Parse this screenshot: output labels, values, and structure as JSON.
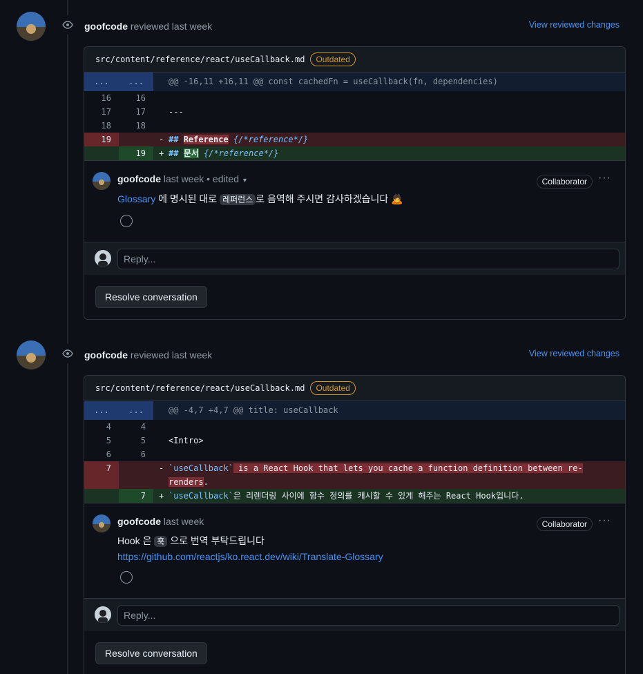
{
  "reviews": [
    {
      "author": "goofcode",
      "action": "reviewed last week",
      "view_link": "View reviewed changes",
      "file": "src/content/reference/react/useCallback.md",
      "badge": "Outdated",
      "hunk": "@@ -16,11 +16,11 @@ const cachedFn = useCallback(fn, dependencies)",
      "lines": [
        {
          "old": "16",
          "new": "16",
          "text": ""
        },
        {
          "old": "17",
          "new": "17",
          "text": "---"
        },
        {
          "old": "18",
          "new": "18",
          "text": ""
        }
      ],
      "del_line": {
        "old": "19",
        "sign": "-",
        "prefix": "## ",
        "hl": "Reference",
        "suffix": " {/*reference*/}"
      },
      "add_line": {
        "new": "19",
        "sign": "+",
        "prefix": "## ",
        "hl": "문서",
        "suffix": " {/*reference*/}"
      },
      "comment": {
        "author": "goofcode",
        "time": "last week",
        "edited": "• edited",
        "role": "Collaborator",
        "link": "Glossary",
        "text1": " 에 명시된 대로 ",
        "chip": "레퍼런스",
        "text2": "로 음역해 주시면 감사하겠습니다 🙇"
      },
      "reply_placeholder": "Reply...",
      "resolve": "Resolve conversation"
    },
    {
      "author": "goofcode",
      "action": "reviewed last week",
      "view_link": "View reviewed changes",
      "file": "src/content/reference/react/useCallback.md",
      "badge": "Outdated",
      "hunk": "@@ -4,7 +4,7 @@ title: useCallback",
      "lines": [
        {
          "old": "4",
          "new": "4",
          "text": ""
        },
        {
          "old": "5",
          "new": "5",
          "text": "<Intro>"
        },
        {
          "old": "6",
          "new": "6",
          "text": ""
        }
      ],
      "del_line": {
        "old": "7",
        "sign": "-",
        "code": "`useCallback`",
        "hl": " is a React Hook that lets you cache a function definition between re-",
        "hl2": "renders",
        "tail": "."
      },
      "add_line": {
        "new": "7",
        "sign": "+",
        "code": "`useCallback`",
        "rest": "은 리렌더링 사이에 함수 정의를 캐시할 수 있게 해주는 React Hook입니다."
      },
      "comment": {
        "author": "goofcode",
        "time": "last week",
        "role": "Collaborator",
        "line1a": "Hook 은 ",
        "chip": "훅",
        "line1b": " 으로 번역 부탁드립니다",
        "link": "https://github.com/reactjs/ko.react.dev/wiki/Translate-Glossary"
      },
      "reply_placeholder": "Reply...",
      "resolve": "Resolve conversation"
    }
  ],
  "hunk_marker": "...",
  "colors": {
    "accent": "#4493f8",
    "outdated": "#d29922",
    "deleted": "#67272a",
    "added": "#1e4a2a"
  }
}
